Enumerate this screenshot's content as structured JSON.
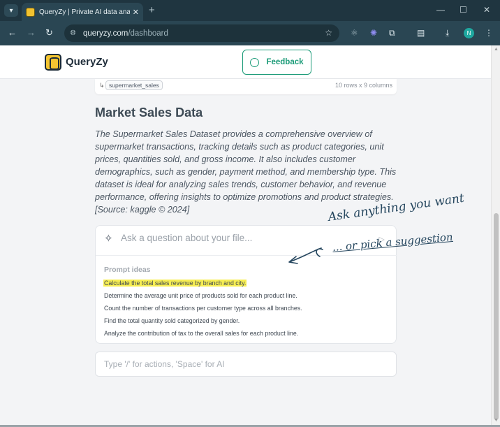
{
  "browser": {
    "tab_title": "QueryZy | Private AI data analy",
    "url_host": "queryzy.com",
    "url_path": "/dashboard",
    "avatar_letter": "N"
  },
  "header": {
    "brand": "QueryZy",
    "feedback_label": "Feedback"
  },
  "file": {
    "name": "supermarket_sales",
    "dimensions": "10 rows x 9 columns"
  },
  "dataset": {
    "title": "Market Sales Data",
    "description": "The Supermarket Sales Dataset provides a comprehensive overview of supermarket transactions, tracking details such as product categories, unit prices, quantities sold, and gross income. It also includes customer demographics, such as gender, payment method, and membership type. This dataset is ideal for analyzing sales trends, customer behavior, and revenue performance, offering insights to optimize promotions and product strategies. [Source: kaggle © 2024]"
  },
  "ask": {
    "placeholder": "Ask a question about your file...",
    "prompt_ideas_label": "Prompt ideas",
    "prompts": [
      "Calculate the total sales revenue by branch and city.",
      "Determine the average unit price of products sold for each product line.",
      "Count the number of transactions per customer type across all branches.",
      "Find the total quantity sold categorized by gender.",
      "Analyze the contribution of tax to the overall sales for each product line."
    ],
    "highlight_color": "#f7ee52"
  },
  "command": {
    "placeholder": "Type '/' for actions, 'Space' for AI"
  },
  "annotation": {
    "line1": "Ask anything you want",
    "line2": "... or pick a suggestion"
  },
  "colors": {
    "accent": "#1b9b78",
    "brand_yellow": "#f4c531",
    "chrome": "#2a4653"
  }
}
